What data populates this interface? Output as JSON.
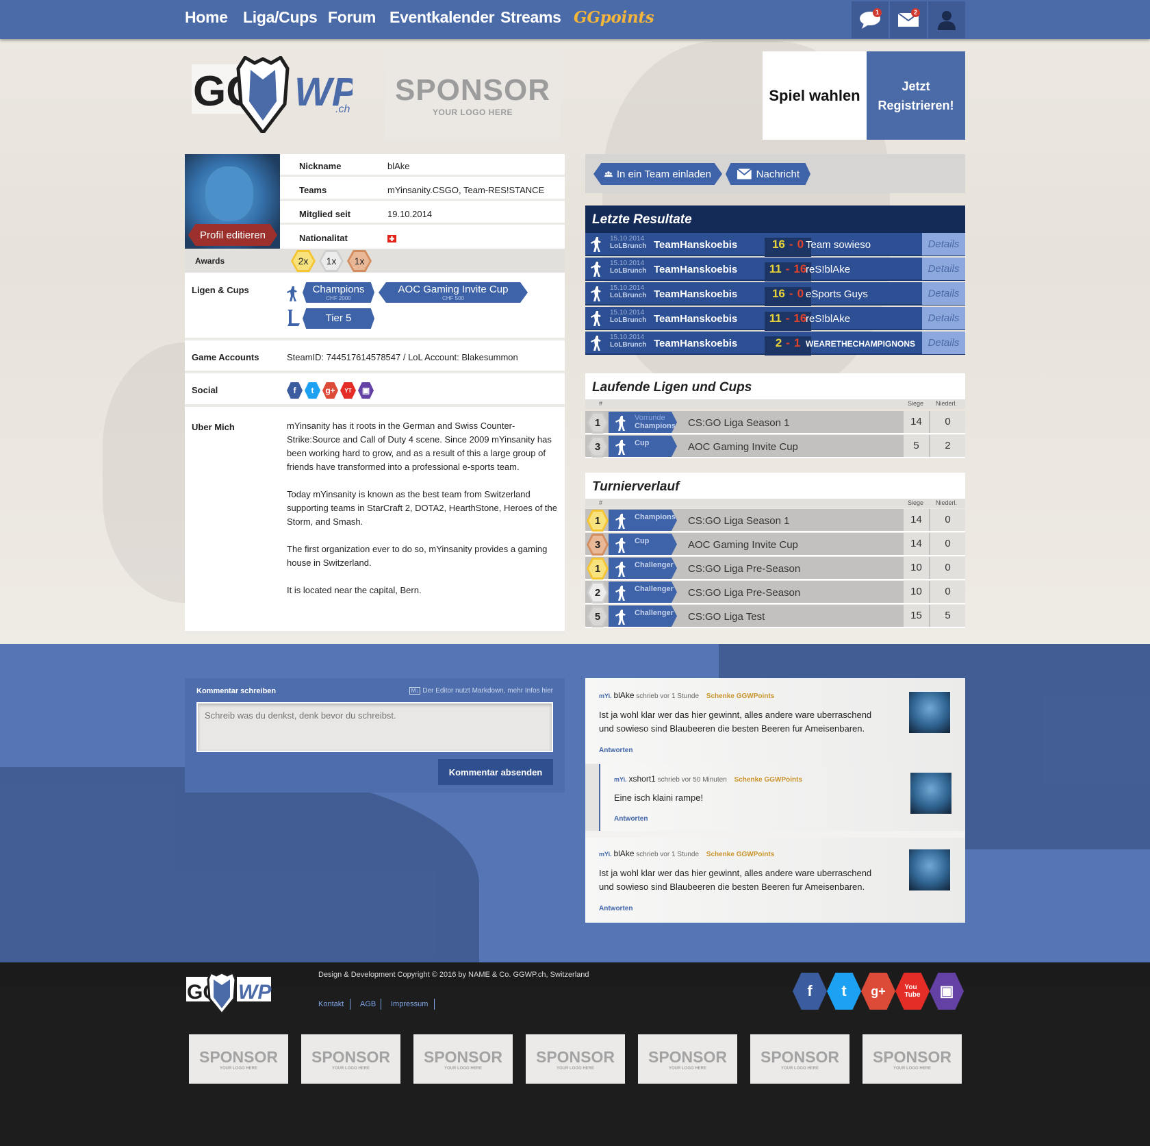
{
  "nav": {
    "items": [
      "Home",
      "Liga/Cups",
      "Forum",
      "Eventkalender",
      "Streams"
    ],
    "ggpoints": "GGpoints",
    "chat_badge": "1",
    "mail_badge": "2"
  },
  "header": {
    "logo_text": "GG WP.ch",
    "sponsor_big": "SPONSOR",
    "sponsor_small": "YOUR LOGO HERE",
    "spiel_wahlen": "Spiel wahlen",
    "register": "Jetzt Registrieren!"
  },
  "profile": {
    "edit_button": "Profil editieren",
    "rows": [
      {
        "label": "Nickname",
        "value": "blAke"
      },
      {
        "label": "Teams",
        "value": "mYinsanity.CSGO, Team-RES!STANCE"
      },
      {
        "label": "Mitglied seit",
        "value": "19.10.2014"
      },
      {
        "label": "Nationalitat",
        "value": ""
      }
    ],
    "awards_label": "Awards",
    "awards": [
      {
        "count": "2x",
        "medal": "gold"
      },
      {
        "count": "1x",
        "medal": "silver"
      },
      {
        "count": "1x",
        "medal": "bronze"
      }
    ],
    "leagues_label": "Ligen & Cups",
    "leagues": [
      {
        "name": "Champions",
        "prize": "CHF 2000"
      },
      {
        "name": "AOC Gaming Invite Cup",
        "prize": "CHF 500"
      },
      {
        "name": "Tier 5",
        "prize": ""
      }
    ],
    "game_accounts_label": "Game Accounts",
    "game_accounts": "SteamID: 744517614578547 / LoL Account: Blakesummon",
    "social_label": "Social",
    "about_label": "Uber Mich",
    "about": [
      "mYinsanity has it roots in the German and Swiss Counter-Strike:Source and Call of Duty 4 scene. Since 2009 mYinsanity has been working hard to grow, and as a result of this a large group of friends have transformed into a professional e-sports team.",
      "Today mYinsanity is known as the best team from Switzerland supporting teams in StarCraft 2, DOTA2, HearthStone, Heroes of the Storm, and Smash.",
      "The first organization ever to do so, mYinsanity provides a gaming house in Switzerland.",
      "It is located near the capital, Bern."
    ]
  },
  "actions": {
    "invite": "In ein Team einladen",
    "message": "Nachricht"
  },
  "results": {
    "title": "Letzte Resultate",
    "rows": [
      {
        "date": "15.10.2014",
        "league": "LoLBrunch",
        "team": "TeamHanskoebis",
        "s1": "16",
        "s2": "0",
        "opp": "Team sowieso",
        "details": "Details"
      },
      {
        "date": "15.10.2014",
        "league": "LoLBrunch",
        "team": "TeamHanskoebis",
        "s1": "11",
        "s2": "16",
        "opp": "reS!blAke",
        "details": "Details"
      },
      {
        "date": "15.10.2014",
        "league": "LoLBrunch",
        "team": "TeamHanskoebis",
        "s1": "16",
        "s2": "0",
        "opp": "eSports Guys",
        "details": "Details"
      },
      {
        "date": "15.10.2014",
        "league": "LoLBrunch",
        "team": "TeamHanskoebis",
        "s1": "11",
        "s2": "16",
        "opp": "reS!blAke",
        "details": "Details"
      },
      {
        "date": "15.10.2014",
        "league": "LoLBrunch",
        "team": "TeamHanskoebis",
        "s1": "2",
        "s2": "1",
        "opp": "WEARETHECHAMPIGNONS",
        "details": "Details"
      }
    ]
  },
  "running": {
    "title": "Laufende Ligen und Cups",
    "head": {
      "pos": "#",
      "wins": "Siege",
      "losses": "Niederl."
    },
    "rows": [
      {
        "pos": "1",
        "sub": "Vorrunde",
        "div": "Champions",
        "name": "CS:GO Liga Season 1",
        "w": "14",
        "l": "0"
      },
      {
        "pos": "3",
        "sub": "",
        "div": "Cup",
        "name": "AOC Gaming Invite Cup",
        "w": "5",
        "l": "2"
      }
    ]
  },
  "history": {
    "title": "Turnierverlauf",
    "head": {
      "pos": "#",
      "wins": "Siege",
      "losses": "Niederl."
    },
    "rows": [
      {
        "pos": "1",
        "medal": "gold",
        "div": "Champions",
        "name": "CS:GO Liga Season 1",
        "w": "14",
        "l": "0"
      },
      {
        "pos": "3",
        "medal": "bronze",
        "div": "Cup",
        "name": "AOC Gaming Invite Cup",
        "w": "14",
        "l": "0"
      },
      {
        "pos": "1",
        "medal": "gold",
        "div": "Challenger",
        "name": "CS:GO Liga Pre-Season",
        "w": "10",
        "l": "0"
      },
      {
        "pos": "2",
        "medal": "silver",
        "div": "Challenger",
        "name": "CS:GO Liga Pre-Season",
        "w": "10",
        "l": "0"
      },
      {
        "pos": "5",
        "medal": "none",
        "div": "Challenger",
        "name": "CS:GO Liga Test",
        "w": "15",
        "l": "5"
      }
    ]
  },
  "comment_form": {
    "title": "Kommentar schreiben",
    "markdown_note": "Der Editor nutzt Markdown, mehr Infos hier",
    "placeholder": "Schreib was du denkst, denk bevor du schreibst.",
    "submit": "Kommentar absenden"
  },
  "comments": [
    {
      "tag": "mYi.",
      "user": "blAke",
      "meta": "schrieb vor 1 Stunde",
      "gg": "Schenke GGWPoints",
      "text": "Ist ja wohl klar wer das hier gewinnt, alles andere ware uberraschend und sowieso sind Blaubeeren die besten Beeren fur Ameisenbaren.",
      "reply": "Antworten"
    },
    {
      "tag": "mYi.",
      "user": "xshort1",
      "meta": "schrieb vor 50 Minuten",
      "gg": "Schenke GGWPoints",
      "text": "Eine isch klaini rampe!",
      "reply": "Antworten"
    },
    {
      "tag": "mYi.",
      "user": "blAke",
      "meta": "schrieb vor 1 Stunde",
      "gg": "Schenke GGWPoints",
      "text": "Ist ja wohl klar wer das hier gewinnt, alles andere ware uberraschend und sowieso sind Blaubeeren die besten Beeren fur Ameisenbaren.",
      "reply": "Antworten"
    }
  ],
  "footer": {
    "copyright": "Design & Development Copyright © 2016 by NAME & Co. GGWP.ch, Switzerland",
    "links": [
      "Kontakt",
      "AGB",
      "Impressum"
    ],
    "sponsor_big": "SPONSOR",
    "sponsor_small": "YOUR LOGO HERE"
  },
  "colors": {
    "primary": "#4a6aa8",
    "dark_blue": "#2d4f93",
    "win": "#e8d43a",
    "loss": "#e2412c",
    "gold": "#f5c531",
    "silver": "#cfcfcf",
    "bronze": "#d28c5e"
  }
}
